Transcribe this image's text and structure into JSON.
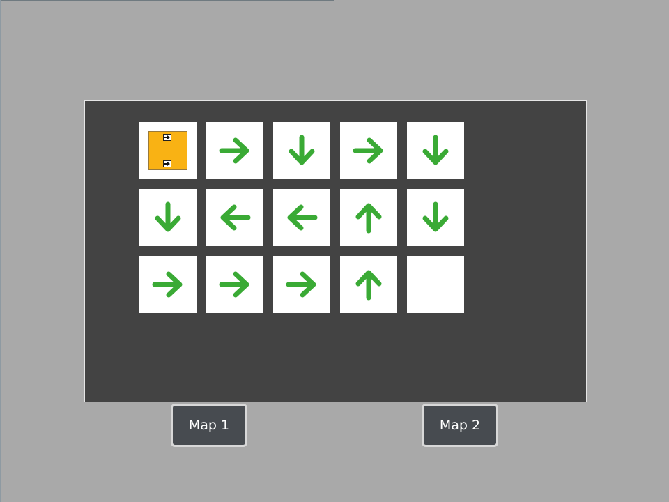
{
  "colors": {
    "background": "#a9a9a9",
    "board": "#434343",
    "tile": "#ffffff",
    "arrow": "#3aaa35",
    "player": "#f9b214",
    "button": "#474b50"
  },
  "grid": {
    "rows": [
      [
        "player",
        "right",
        "down",
        "right",
        "down"
      ],
      [
        "down",
        "left",
        "left",
        "up",
        "down"
      ],
      [
        "right",
        "right",
        "right",
        "up",
        "empty"
      ]
    ]
  },
  "player": {
    "badge_icons": [
      "arrow-right-icon",
      "arrow-right-icon"
    ]
  },
  "buttons": {
    "map1_label": "Map 1",
    "map2_label": "Map 2"
  }
}
